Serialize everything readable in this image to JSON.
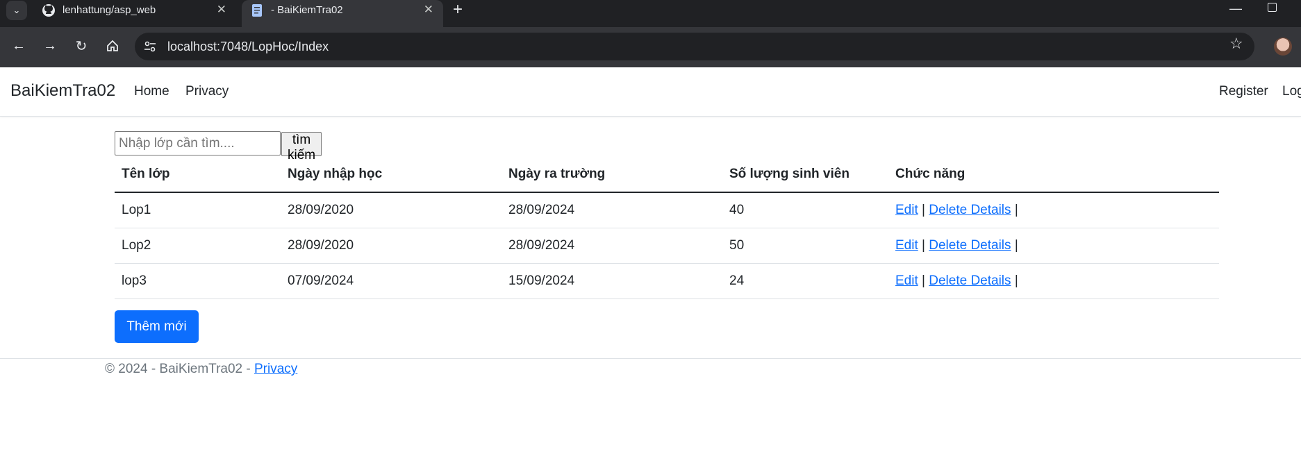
{
  "browser": {
    "tabs": [
      {
        "title": "lenhattung/asp_web",
        "icon": "github-icon"
      },
      {
        "title": "- BaiKiemTra02",
        "icon": "page-icon"
      }
    ],
    "url": "localhost:7048/LopHoc/Index"
  },
  "navbar": {
    "brand": "BaiKiemTra02",
    "links": [
      "Home",
      "Privacy"
    ],
    "right_links": [
      "Register",
      "Log"
    ]
  },
  "search": {
    "placeholder": "Nhập lớp cần tìm....",
    "button": "tìm kiếm"
  },
  "table": {
    "headers": [
      "Tên lớp",
      "Ngày nhập học",
      "Ngày ra trường",
      "Số lượng sinh viên",
      "Chức năng"
    ],
    "rows": [
      [
        "Lop1",
        "28/09/2020",
        "28/09/2024",
        "40"
      ],
      [
        "Lop2",
        "28/09/2020",
        "28/09/2024",
        "50"
      ],
      [
        "lop3",
        "07/09/2024",
        "15/09/2024",
        "24"
      ]
    ],
    "actions": {
      "edit": "Edit",
      "delete_details": "Delete Details",
      "separator": "|"
    }
  },
  "add_button": "Thêm mới",
  "footer": {
    "text": "© 2024 - BaiKiemTra02 - ",
    "privacy": "Privacy"
  }
}
